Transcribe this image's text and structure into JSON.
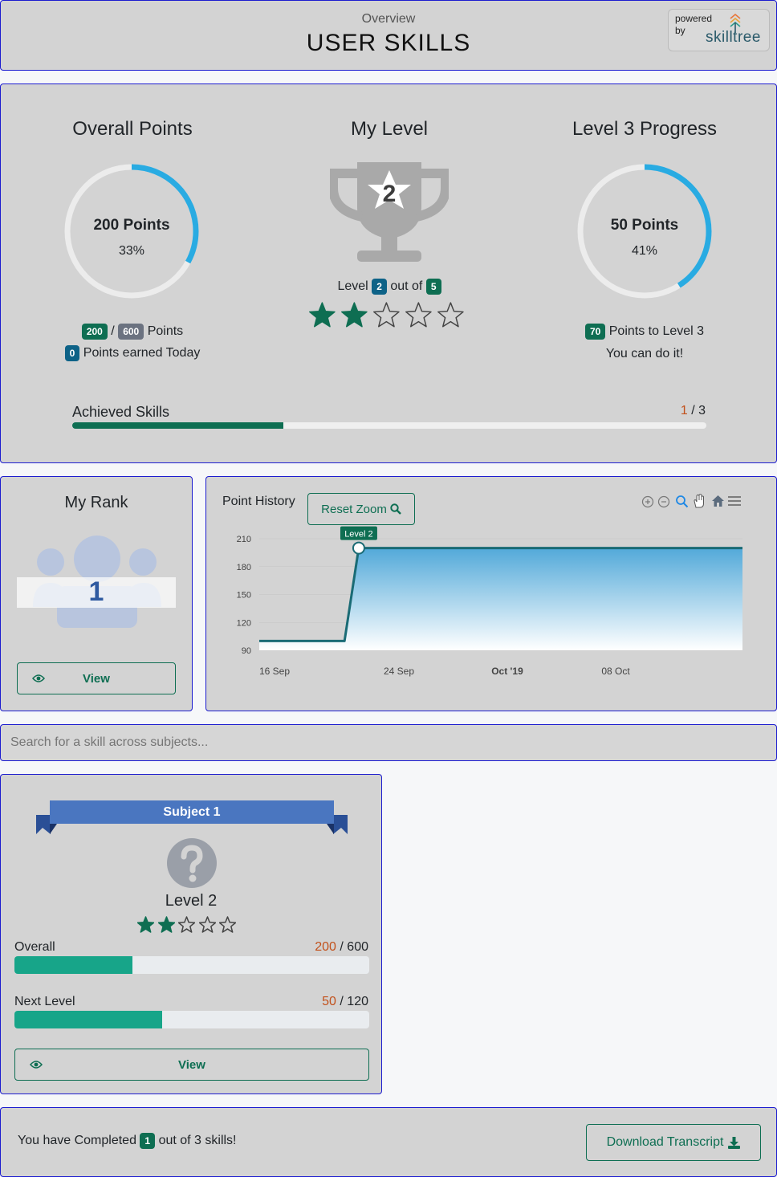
{
  "header": {
    "subtitle": "Overview",
    "title": "USER SKILLS",
    "powered_by": "powered",
    "powered_by_2": "by",
    "brand": "skilltree"
  },
  "overall": {
    "heading": "Overall Points",
    "points_label": "200 Points",
    "percent_label": "33%",
    "percent": 0.33,
    "earned": "200",
    "total": "600",
    "points_word": "Points",
    "today": "0",
    "today_label": "Points earned Today"
  },
  "level": {
    "heading": "My Level",
    "trophy_number": "2",
    "level_word": "Level",
    "current": "2",
    "out_of": "out of",
    "max": "5",
    "stars_filled": 2,
    "stars_total": 5
  },
  "progress": {
    "heading": "Level 3 Progress",
    "points_label": "50 Points",
    "percent_label": "41%",
    "percent": 0.41,
    "remaining": "70",
    "remaining_label": "Points to Level 3",
    "encourage": "You can do it!"
  },
  "achieved": {
    "label": "Achieved Skills",
    "done": "1",
    "total": "/ 3",
    "fraction": 0.333
  },
  "rank": {
    "heading": "My Rank",
    "value": "1",
    "view_label": "View"
  },
  "history": {
    "title": "Point History",
    "reset_label": "Reset Zoom",
    "marker_label": "Level 2",
    "toolbar_icons": [
      "zoom-in-icon",
      "zoom-out-icon",
      "zoom-select-icon",
      "pan-hand-icon",
      "home-icon",
      "menu-icon"
    ]
  },
  "chart_data": {
    "type": "area",
    "x": [
      "2019-09-13",
      "2019-09-19",
      "2019-09-20",
      "2019-10-17"
    ],
    "values": [
      100,
      100,
      200,
      200
    ],
    "x_ticks": [
      "16 Sep",
      "24 Sep",
      "Oct '19",
      "08 Oct"
    ],
    "y_ticks": [
      "210",
      "180",
      "150",
      "120",
      "90"
    ],
    "ylim": [
      90,
      210
    ],
    "annotation": "Level 2",
    "colors": {
      "line": "#1a6b75",
      "fill_top": "#52a9d9",
      "fill_bottom": "#ffffff"
    }
  },
  "search": {
    "placeholder": "Search for a skill across subjects..."
  },
  "subject": {
    "ribbon": "Subject 1",
    "level_label": "Level 2",
    "stars_filled": 2,
    "stars_total": 5,
    "overall_label": "Overall",
    "overall_earned": "200",
    "overall_total": "/ 600",
    "overall_fraction": 0.333,
    "next_label": "Next Level",
    "next_earned": "50",
    "next_total": "/ 120",
    "next_fraction": 0.417,
    "view_label": "View"
  },
  "footer": {
    "prefix": "You have Completed",
    "count": "1",
    "suffix": "out of 3 skills!",
    "download_label": "Download Transcript"
  },
  "colors": {
    "accent_green": "#0e6e52",
    "donut_blue": "#29abe2",
    "progress_teal": "#17a589",
    "orange": "#c2501a",
    "ribbon_blue": "#4a76c0"
  }
}
